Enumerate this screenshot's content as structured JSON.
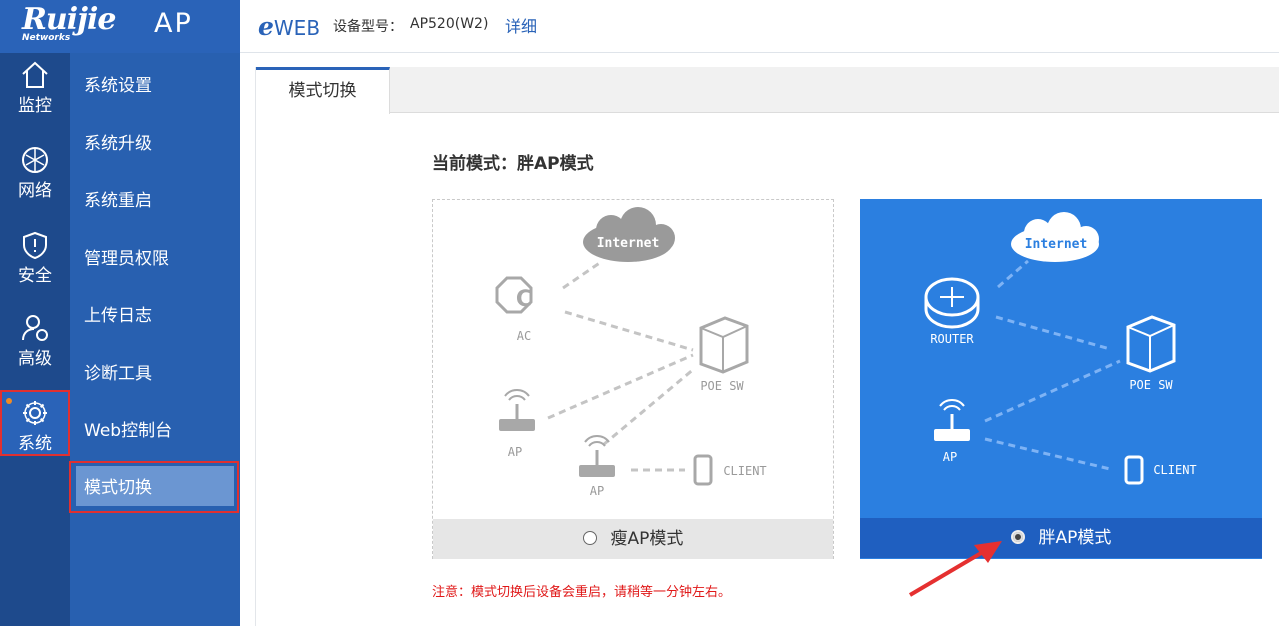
{
  "brand": {
    "logo": "Ruijie",
    "networks": "Networks",
    "product": "AP"
  },
  "topbar": {
    "eweb_e": "e",
    "eweb_rest": "WEB",
    "model_label": "设备型号：",
    "model_value": "AP520(W2)",
    "detail_link": "详细"
  },
  "rail": [
    {
      "label": "监控",
      "icon": "home-icon"
    },
    {
      "label": "网络",
      "icon": "network-icon"
    },
    {
      "label": "安全",
      "icon": "shield-icon"
    },
    {
      "label": "高级",
      "icon": "user-gear-icon"
    },
    {
      "label": "系统",
      "icon": "gear-icon",
      "active": true
    }
  ],
  "submenu": [
    "系统设置",
    "系统升级",
    "系统重启",
    "管理员权限",
    "上传日志",
    "诊断工具",
    "Web控制台",
    "模式切换"
  ],
  "tab": {
    "label": "模式切换"
  },
  "mode": {
    "current_label": "当前模式：",
    "current_value": "胖AP模式"
  },
  "fit_card": {
    "option_label": "瘦AP模式",
    "selected": false,
    "nodes": {
      "cloud": "Internet",
      "controller": "AC",
      "switch": "POE SW",
      "ap1": "AP",
      "ap2": "AP",
      "client": "CLIENT"
    }
  },
  "fat_card": {
    "option_label": "胖AP模式",
    "selected": true,
    "nodes": {
      "cloud": "Internet",
      "router": "ROUTER",
      "switch": "POE SW",
      "ap": "AP",
      "client": "CLIENT"
    }
  },
  "notice": "注意：模式切换后设备会重启，请稍等一分钟左右。",
  "colors": {
    "accent": "#2a63b8",
    "fat_card_bg": "#2b7fe0",
    "warning": "#e01818",
    "highlight": "#e03030"
  }
}
